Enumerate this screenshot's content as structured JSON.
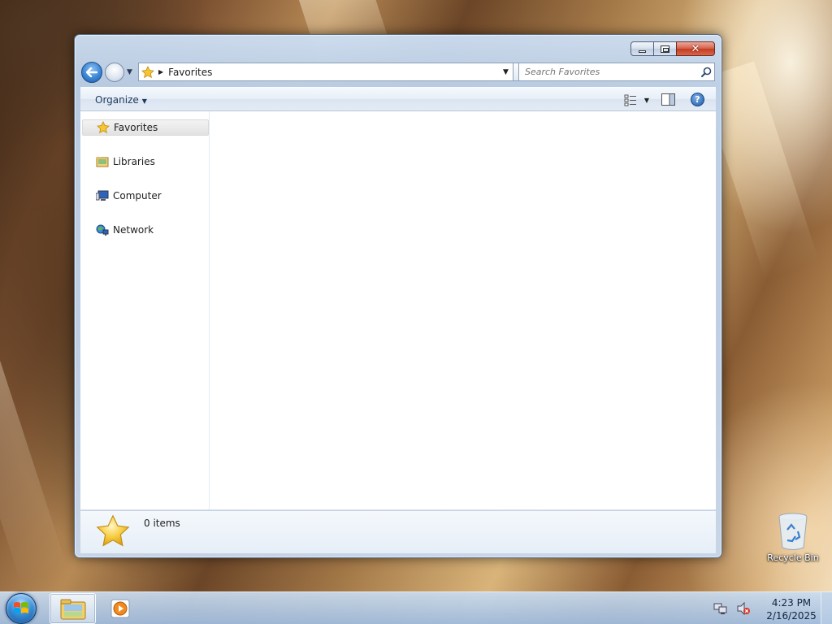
{
  "window": {
    "caption_buttons": {
      "minimize": "minimize",
      "maximize": "maximize",
      "close": "✕"
    },
    "address": {
      "location": "Favorites"
    },
    "search": {
      "placeholder": "Search Favorites"
    },
    "toolbar": {
      "organize_label": "Organize"
    },
    "navigation": {
      "items": [
        {
          "label": "Favorites",
          "icon": "star-icon",
          "selected": true
        },
        {
          "label": "Libraries",
          "icon": "libraries-icon",
          "selected": false
        },
        {
          "label": "Computer",
          "icon": "computer-icon",
          "selected": false
        },
        {
          "label": "Network",
          "icon": "network-icon",
          "selected": false
        }
      ]
    },
    "details": {
      "item_count": "0 items"
    }
  },
  "desktop": {
    "icons": [
      {
        "label": "Recycle Bin",
        "icon": "recycle-bin-icon"
      }
    ]
  },
  "taskbar": {
    "pinned": [
      {
        "name": "windows-explorer",
        "active": true
      },
      {
        "name": "media-player",
        "active": false
      }
    ],
    "clock": {
      "time": "4:23 PM",
      "date": "2/16/2025"
    }
  },
  "colors": {
    "accent": "#3c86d6",
    "close": "#c23d22"
  }
}
